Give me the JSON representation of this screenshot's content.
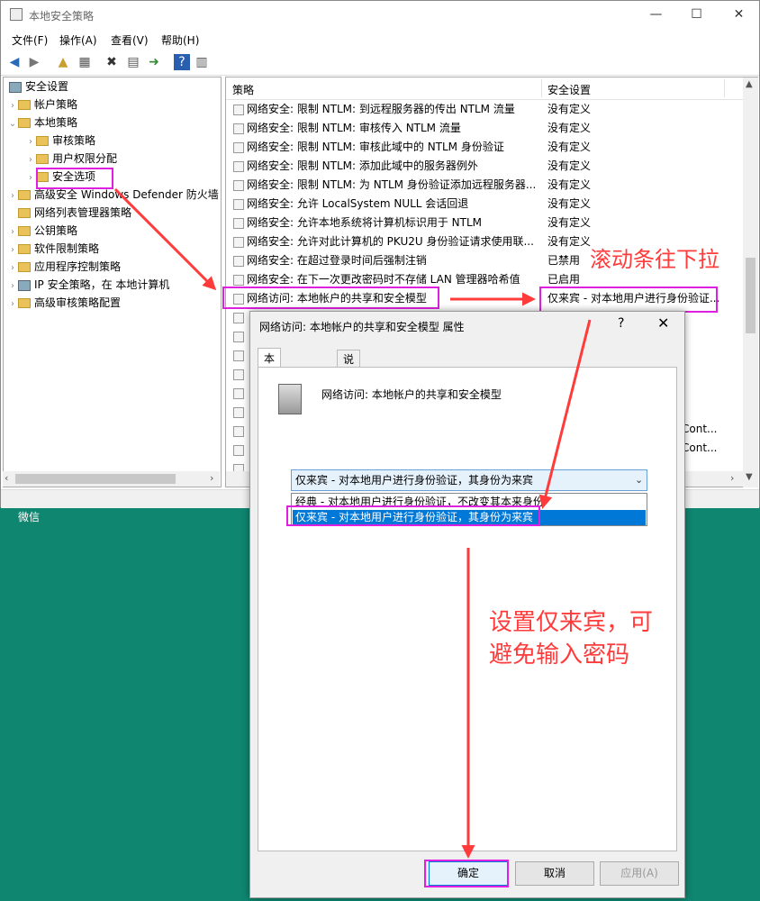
{
  "window": {
    "title": "本地安全策略",
    "minimize": "—",
    "maximize": "☐",
    "close": "✕"
  },
  "menu": [
    "文件(F)",
    "操作(A)",
    "查看(V)",
    "帮助(H)"
  ],
  "tree": {
    "root": "安全设置",
    "items": [
      {
        "label": "帐户策略",
        "level": 1,
        "expanded": false
      },
      {
        "label": "本地策略",
        "level": 1,
        "expanded": true
      },
      {
        "label": "审核策略",
        "level": 2,
        "expanded": false
      },
      {
        "label": "用户权限分配",
        "level": 2,
        "expanded": false
      },
      {
        "label": "安全选项",
        "level": 2,
        "expanded": false,
        "selected": true
      },
      {
        "label": "高级安全 Windows Defender 防火墙",
        "level": 1,
        "expanded": false
      },
      {
        "label": "网络列表管理器策略",
        "level": 1,
        "expanded": false
      },
      {
        "label": "公钥策略",
        "level": 1,
        "expanded": false
      },
      {
        "label": "软件限制策略",
        "level": 1,
        "expanded": false
      },
      {
        "label": "应用程序控制策略",
        "level": 1,
        "expanded": false
      },
      {
        "label": "IP 安全策略，在 本地计算机",
        "level": 1,
        "expanded": false
      },
      {
        "label": "高级审核策略配置",
        "level": 1,
        "expanded": false
      }
    ]
  },
  "list": {
    "col_policy": "策略",
    "col_setting": "安全设置",
    "rows": [
      {
        "policy": "网络安全: 限制 NTLM: 到远程服务器的传出 NTLM 流量",
        "setting": "没有定义"
      },
      {
        "policy": "网络安全: 限制 NTLM: 审核传入 NTLM 流量",
        "setting": "没有定义"
      },
      {
        "policy": "网络安全: 限制 NTLM: 审核此域中的 NTLM 身份验证",
        "setting": "没有定义"
      },
      {
        "policy": "网络安全: 限制 NTLM: 添加此域中的服务器例外",
        "setting": "没有定义"
      },
      {
        "policy": "网络安全: 限制 NTLM: 为 NTLM 身份验证添加远程服务器...",
        "setting": "没有定义"
      },
      {
        "policy": "网络安全: 允许 LocalSystem NULL 会话回退",
        "setting": "没有定义"
      },
      {
        "policy": "网络安全: 允许本地系统将计算机标识用于 NTLM",
        "setting": "没有定义"
      },
      {
        "policy": "网络安全: 允许对此计算机的 PKU2U 身份验证请求使用联...",
        "setting": "没有定义"
      },
      {
        "policy": "网络安全: 在超过登录时间后强制注销",
        "setting": "已禁用"
      },
      {
        "policy": "网络安全: 在下一次更改密码时不存储 LAN 管理器哈希值",
        "setting": "已启用"
      },
      {
        "policy": "网络访问: 本地帐户的共享和安全模型",
        "setting": "仅来宾 - 对本地用户进行身份验证..."
      }
    ],
    "partial_right": [
      "Cont...",
      "Cont..."
    ]
  },
  "taskbar_label": "微信",
  "dialog": {
    "title": "网络访问: 本地帐户的共享和安全模型 属性",
    "help": "?",
    "close": "✕",
    "tabs": [
      "本地安全设置",
      "说明"
    ],
    "policy_name": "网络访问: 本地帐户的共享和安全模型",
    "select_value": "仅来宾 - 对本地用户进行身份验证，其身份为来宾",
    "options": [
      "经典 - 对本地用户进行身份验证，不改变其本来身份",
      "仅来宾 - 对本地用户进行身份验证，其身份为来宾"
    ],
    "ok": "确定",
    "cancel": "取消",
    "apply": "应用(A)"
  },
  "annotations": {
    "scroll_hint": "滚动条往下拉",
    "guest_hint_line1": "设置仅来宾，可",
    "guest_hint_line2": "避免输入密码",
    "color": "#ff3b3b"
  }
}
